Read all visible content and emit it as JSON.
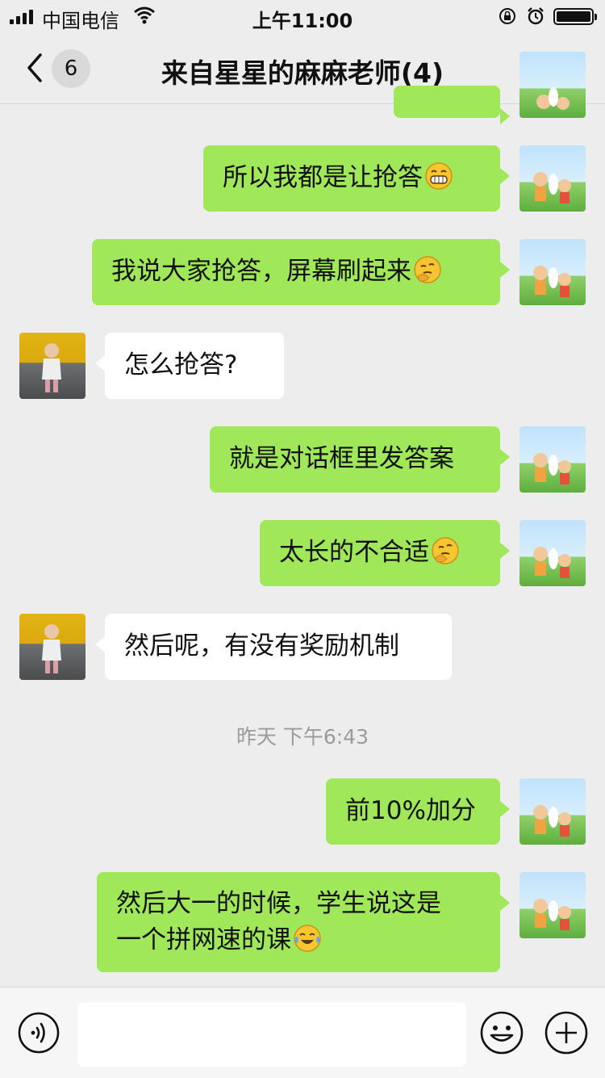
{
  "status_bar": {
    "carrier": "中国电信",
    "time": "上午11:00"
  },
  "nav": {
    "unread_count": "6",
    "title": "来自星星的麻麻老师(4)"
  },
  "messages": [
    {
      "side": "out",
      "text": "所以我都是让抢答",
      "emoji": "grinning-emoji"
    },
    {
      "side": "out",
      "text": "我说大家抢答，屏幕刷起来",
      "emoji": "facepalm-emoji"
    },
    {
      "side": "in",
      "text": "怎么抢答?"
    },
    {
      "side": "out",
      "text": "就是对话框里发答案"
    },
    {
      "side": "out",
      "text": "太长的不合适",
      "emoji": "facepalm-emoji"
    },
    {
      "side": "in",
      "text": "然后呢，有没有奖励机制"
    },
    {
      "side": "out",
      "text": "前10%加分"
    },
    {
      "side": "out",
      "text": "然后大一的时候，学生说这是\n一个拼网速的课",
      "emoji": "tears-of-joy-emoji"
    }
  ],
  "timestamp": "昨天 下午6:43",
  "colors": {
    "outgoing_bubble": "#a0e75a",
    "incoming_bubble": "#ffffff",
    "background": "#ededed"
  }
}
